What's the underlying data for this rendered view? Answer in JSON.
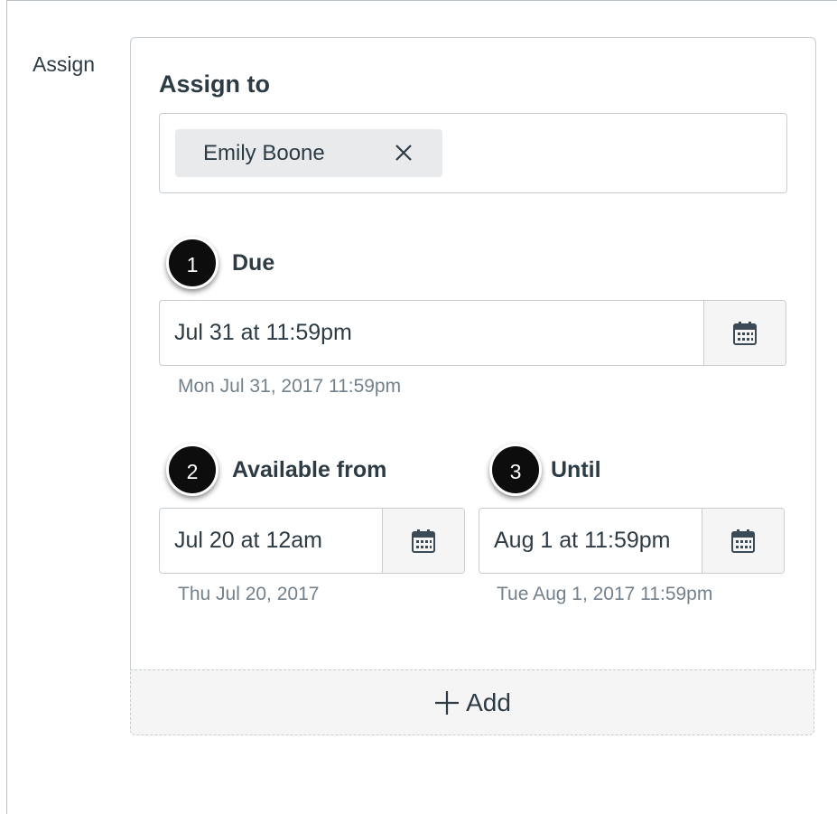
{
  "assign": {
    "section_label": "Assign",
    "assign_to_label": "Assign to",
    "assignees": [
      {
        "name": "Emily Boone"
      }
    ]
  },
  "due": {
    "callout": "1",
    "label": "Due",
    "value": "Jul 31 at 11:59pm",
    "hint": "Mon Jul 31, 2017 11:59pm"
  },
  "available_from": {
    "callout": "2",
    "label": "Available from",
    "value": "Jul 20 at 12am",
    "hint": "Thu Jul 20, 2017"
  },
  "until": {
    "callout": "3",
    "label": "Until",
    "value": "Aug 1 at 11:59pm",
    "hint": "Tue Aug 1, 2017 11:59pm"
  },
  "add_button": {
    "label": "Add"
  },
  "icons": {
    "calendar": "calendar-icon",
    "remove": "close-icon",
    "add": "plus-icon"
  },
  "colors": {
    "text": "#2d3b45",
    "hint": "#73818c",
    "border": "#c7cdd1",
    "button_bg": "#f5f5f5",
    "token_bg": "#e8eaec",
    "callout_bg": "#0d0d0d"
  }
}
